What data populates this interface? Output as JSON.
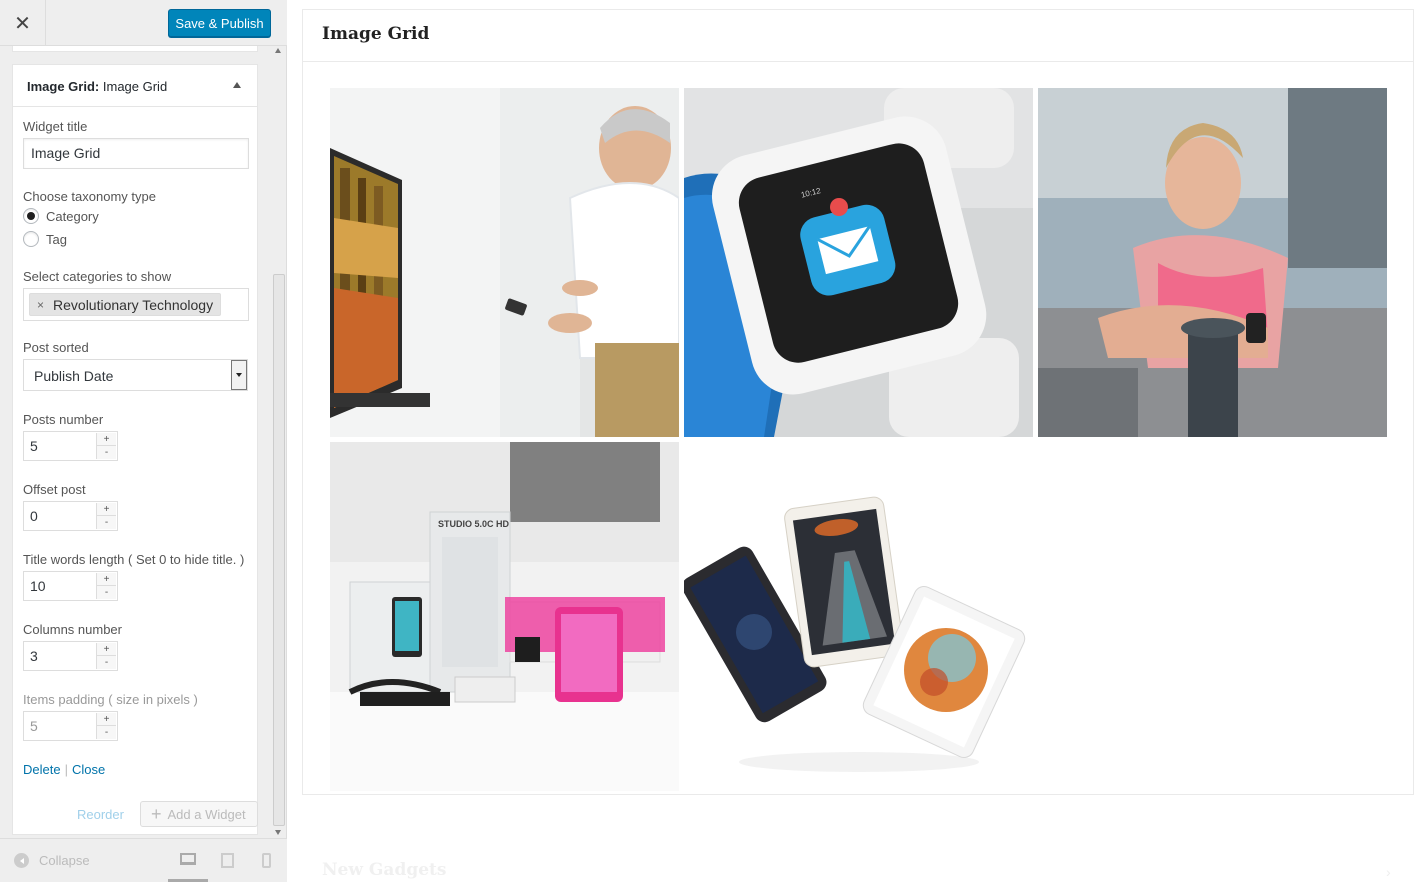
{
  "header": {
    "close_icon": "close-icon",
    "save_label": "Save & Publish"
  },
  "widget": {
    "type_label": "Image Grid:",
    "name": "Image Grid",
    "fields": {
      "title_label": "Widget title",
      "title_value": "Image Grid",
      "taxonomy_label": "Choose taxonomy type",
      "taxonomy_options": [
        "Category",
        "Tag"
      ],
      "taxonomy_selected": "Category",
      "categories_label": "Select categories to show",
      "categories_selected": [
        "Revolutionary Technology"
      ],
      "sort_label": "Post sorted",
      "sort_value": "Publish Date",
      "posts_number_label": "Posts number",
      "posts_number_value": "5",
      "offset_label": "Offset post",
      "offset_value": "0",
      "title_words_label": "Title words length ( Set 0 to hide title. )",
      "title_words_value": "10",
      "columns_label": "Columns number",
      "columns_value": "3",
      "padding_label": "Items padding ( size in pixels )",
      "padding_value": "5"
    },
    "actions": {
      "delete": "Delete",
      "separator": "|",
      "close": "Close"
    }
  },
  "footer_actions": {
    "reorder": "Reorder",
    "add_widget": "Add a Widget"
  },
  "sidebar_footer": {
    "collapse": "Collapse",
    "devices": [
      "desktop-icon",
      "tablet-icon",
      "mobile-icon"
    ]
  },
  "preview": {
    "grid_title": "Image Grid",
    "images": [
      "man-with-curved-tv",
      "smartwatch-mail",
      "woman-stretching",
      "blu-phone-box",
      "ipads-floating"
    ],
    "next_widget_title": "New Gadgets"
  },
  "spinner": {
    "up": "+",
    "down": "-"
  },
  "tag_remove": "×",
  "add_icon": "+"
}
